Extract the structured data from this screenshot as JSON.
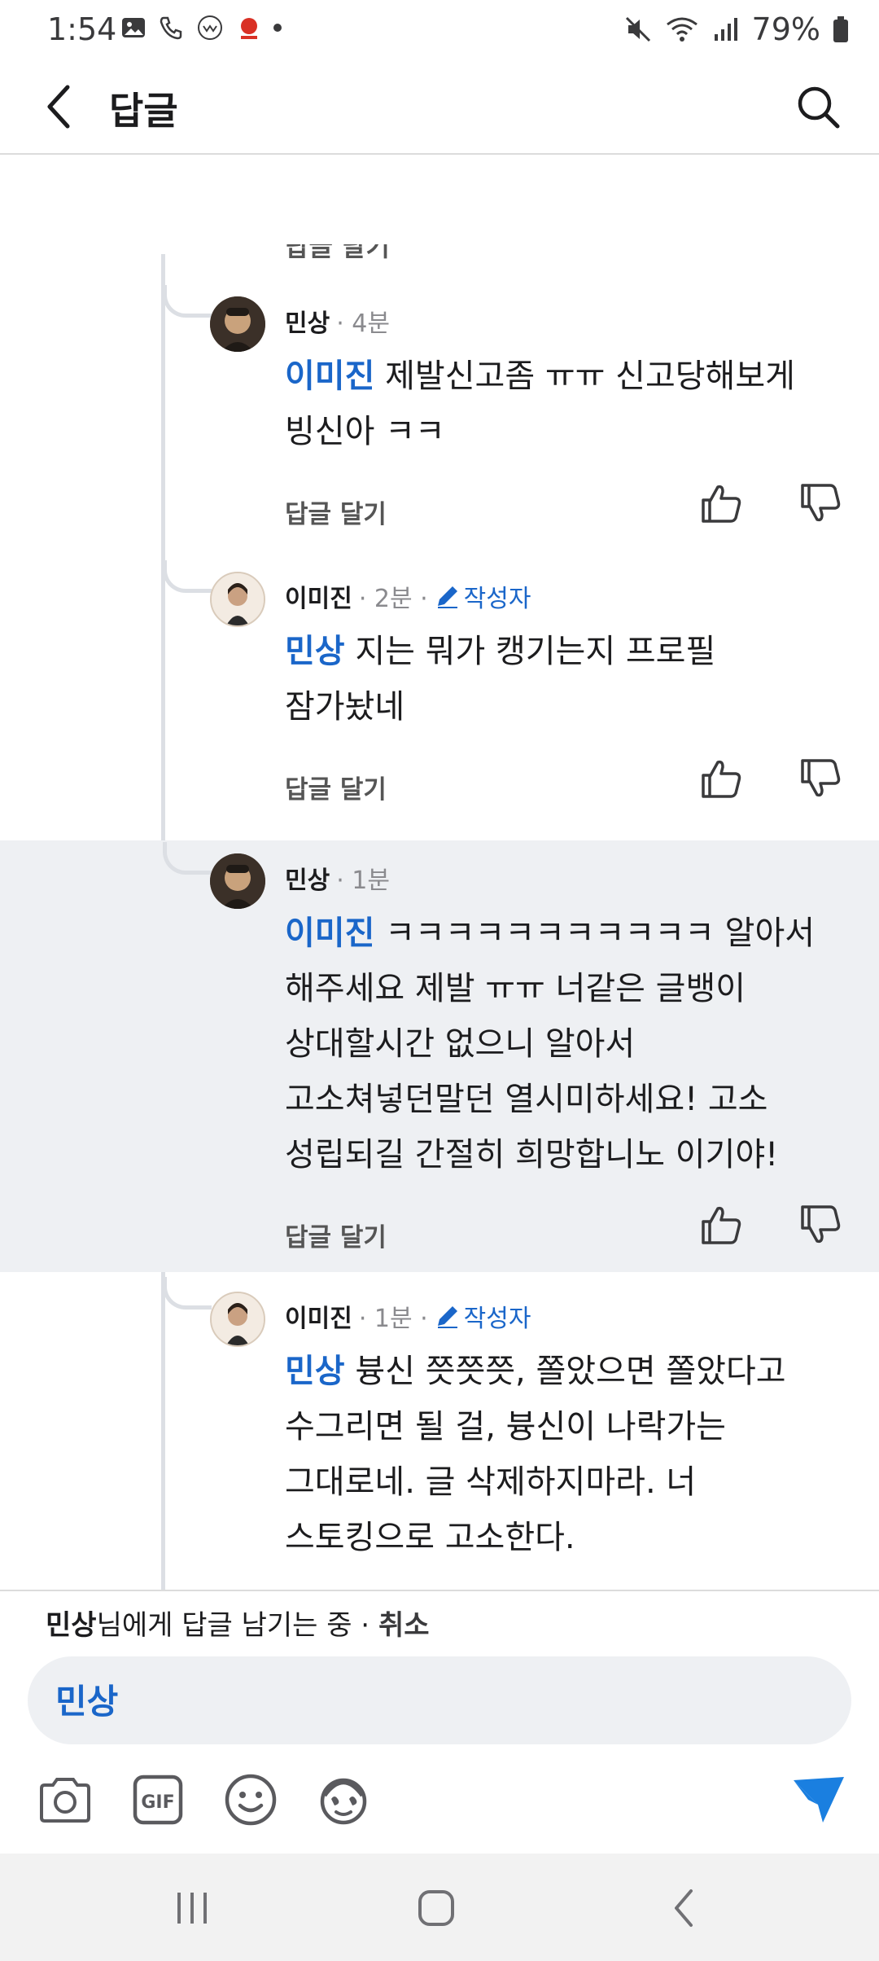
{
  "status_bar": {
    "time": "1:54",
    "battery": "79%"
  },
  "app_bar": {
    "title": "답글"
  },
  "partial_reply_label": "답글 달기",
  "comments": [
    {
      "author": "민상",
      "time": "· 4분",
      "op_badge": "",
      "mention": "이미진",
      "text_lines": [
        "제발신고좀 ㅠㅠ 신고당해보게",
        "빙신아 ㅋㅋ"
      ],
      "reply_label": "답글 달기"
    },
    {
      "author": "이미진",
      "time": "· 2분 ·",
      "op_badge": "작성자",
      "mention": "민상",
      "text_lines": [
        "지는 뭐가 캥기는지 프로필",
        "잠가놨네"
      ],
      "reply_label": "답글 달기"
    },
    {
      "author": "민상",
      "time": "· 1분",
      "op_badge": "",
      "mention": "이미진",
      "text_lines": [
        "ㅋㅋㅋㅋㅋㅋㅋㅋㅋㅋㅋ 알아서",
        "해주세요 제발 ㅠㅠ 너같은 글뱅이",
        "상대할시간 없으니 알아서",
        "고소쳐넣던말던 열시미하세요! 고소",
        "성립되길 간절히 희망합니노 이기야!"
      ],
      "reply_label": "답글 달기"
    },
    {
      "author": "이미진",
      "time": "· 1분 ·",
      "op_badge": "작성자",
      "mention": "민상",
      "text_lines": [
        "븅신 쯧쯧쯧, 쫄았으면 쫄았다고",
        "수그리면 될 걸, 븅신이 나락가는",
        "그대로네. 글 삭제하지마라. 너",
        "스토킹으로 고소한다."
      ],
      "reply_label": ""
    }
  ],
  "reply_context": {
    "name": "민상",
    "suffix": "님에게 답글 남기는 중 ·",
    "cancel": "취소"
  },
  "input": {
    "value": "민상"
  },
  "toolbar": {
    "gif_label": "GIF"
  },
  "colors": {
    "accent": "#1a66c9",
    "highlight_bg": "#eef0f3",
    "send": "#1a7fe0"
  }
}
